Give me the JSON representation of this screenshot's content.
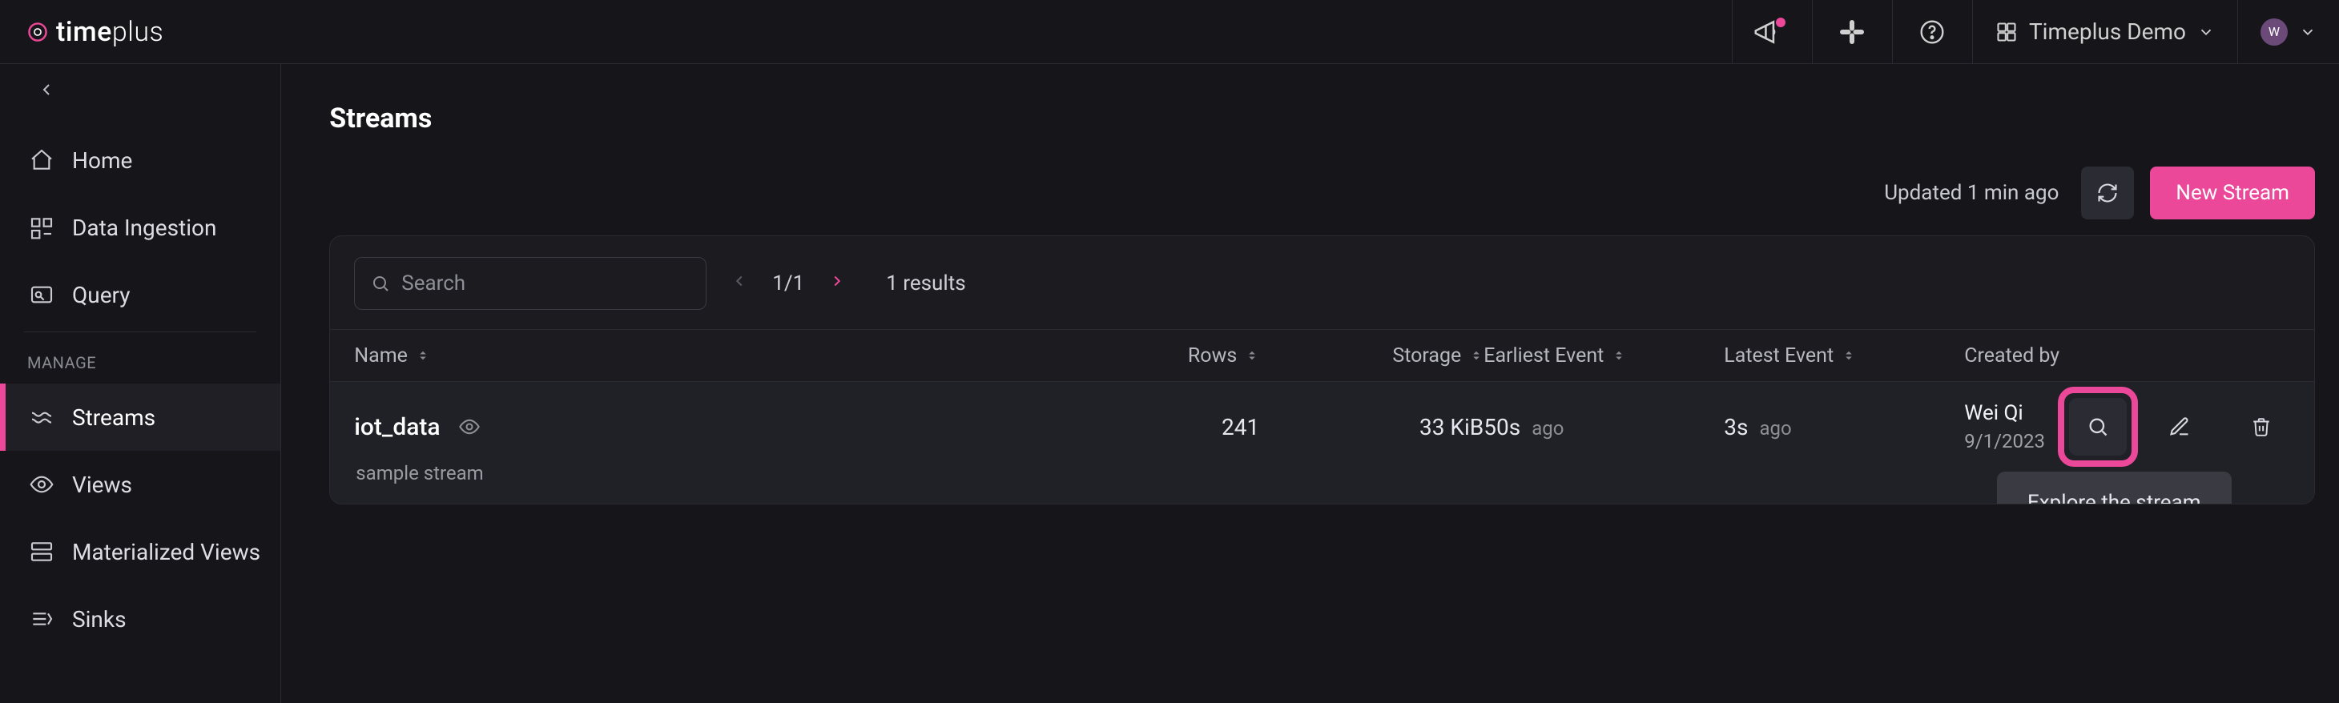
{
  "brand": {
    "name_main": "time",
    "name_suffix": "plus"
  },
  "top": {
    "workspace_label": "Timeplus Demo",
    "avatar_initial": "W"
  },
  "sidebar": {
    "heading_manage": "MANAGE",
    "items": {
      "home": "Home",
      "data_ingestion": "Data Ingestion",
      "query": "Query",
      "streams": "Streams",
      "views": "Views",
      "mviews": "Materialized Views",
      "sinks": "Sinks"
    }
  },
  "page": {
    "title": "Streams",
    "updated_text": "Updated 1 min ago",
    "new_button": "New Stream",
    "search_placeholder": "Search",
    "page_indicator": "1/1",
    "results_text": "1 results"
  },
  "columns": {
    "name": "Name",
    "rows": "Rows",
    "storage": "Storage",
    "earliest": "Earliest Event",
    "latest": "Latest Event",
    "created_by": "Created by"
  },
  "rows": [
    {
      "name": "iot_data",
      "description": "sample stream",
      "rows": "241",
      "storage": "33 KiB",
      "earliest_val": "50s",
      "earliest_ago": "ago",
      "latest_val": "3s",
      "latest_ago": "ago",
      "creator_name": "Wei Qi",
      "creator_date": "9/1/2023"
    }
  ],
  "tooltip": {
    "explore": "Explore the stream"
  }
}
